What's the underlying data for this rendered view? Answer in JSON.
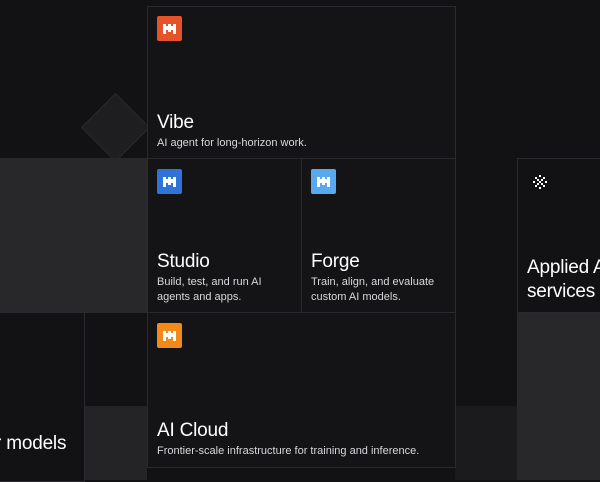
{
  "cards": {
    "vibe": {
      "title": "Vibe",
      "description": "AI agent for long-horizon work.",
      "logo_color": "#e4532a",
      "logo_icon": "m-logo-icon"
    },
    "studio": {
      "title": "Studio",
      "description": "Build, test, and run AI agents and apps.",
      "logo_color": "#2f73d8",
      "logo_icon": "m-logo-icon"
    },
    "forge": {
      "title": "Forge",
      "description": "Train, align, and evaluate custom AI models.",
      "logo_color": "#5aa9f0",
      "logo_icon": "m-logo-icon"
    },
    "ai_cloud": {
      "title": "AI Cloud",
      "description": "Frontier-scale infrastructure for training and inference.",
      "logo_color": "#f08a18",
      "logo_icon": "m-logo-icon"
    },
    "applied": {
      "title_line1": "Applied A",
      "title_line2": "services",
      "icon": "sparkle-icon"
    },
    "models": {
      "title": "r models"
    }
  }
}
